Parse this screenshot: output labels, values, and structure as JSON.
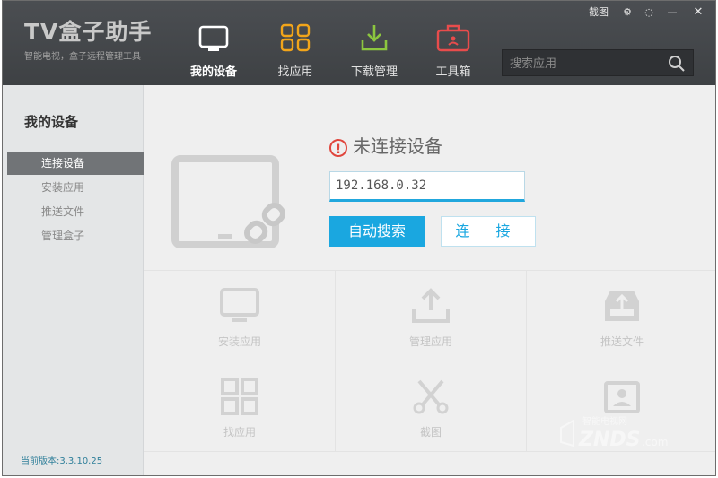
{
  "brand": {
    "title": "TV盒子助手",
    "subtitle": "智能电视，盒子远程管理工具"
  },
  "nav": [
    {
      "label": "我的设备",
      "icon": "tv-icon",
      "color": "#ffffff"
    },
    {
      "label": "找应用",
      "icon": "grid-icon",
      "color": "#f2a51a"
    },
    {
      "label": "下载管理",
      "icon": "download-icon",
      "color": "#8cc63f"
    },
    {
      "label": "工具箱",
      "icon": "toolbox-icon",
      "color": "#e84c4c"
    }
  ],
  "search": {
    "placeholder": "搜索应用"
  },
  "window_controls": {
    "screenshot": "截图",
    "settings": "⚙",
    "feedback": "◌",
    "minimize": "—",
    "close": "✕"
  },
  "sidebar": {
    "title": "我的设备",
    "items": [
      "连接设备",
      "安装应用",
      "推送文件",
      "管理盒子"
    ],
    "active_index": 0,
    "version": "当前版本:3.3.10.25"
  },
  "connect": {
    "status": "未连接设备",
    "ip_value": "192.168.0.32",
    "auto_search": "自动搜索",
    "connect": "连 接"
  },
  "tiles": [
    {
      "label": "安装应用",
      "icon": "monitor-icon"
    },
    {
      "label": "管理应用",
      "icon": "upload-icon"
    },
    {
      "label": "推送文件",
      "icon": "inbox-upload-icon"
    },
    {
      "label": "找应用",
      "icon": "grid-icon"
    },
    {
      "label": "截图",
      "icon": "scissors-icon"
    },
    {
      "label": "",
      "icon": "contact-icon"
    }
  ],
  "watermark": {
    "site": "ZNDS.com",
    "tagline": "智能电视网"
  },
  "colors": {
    "accent": "#1aa7e0",
    "topbar": "#45484b",
    "warning": "#e0463d"
  }
}
